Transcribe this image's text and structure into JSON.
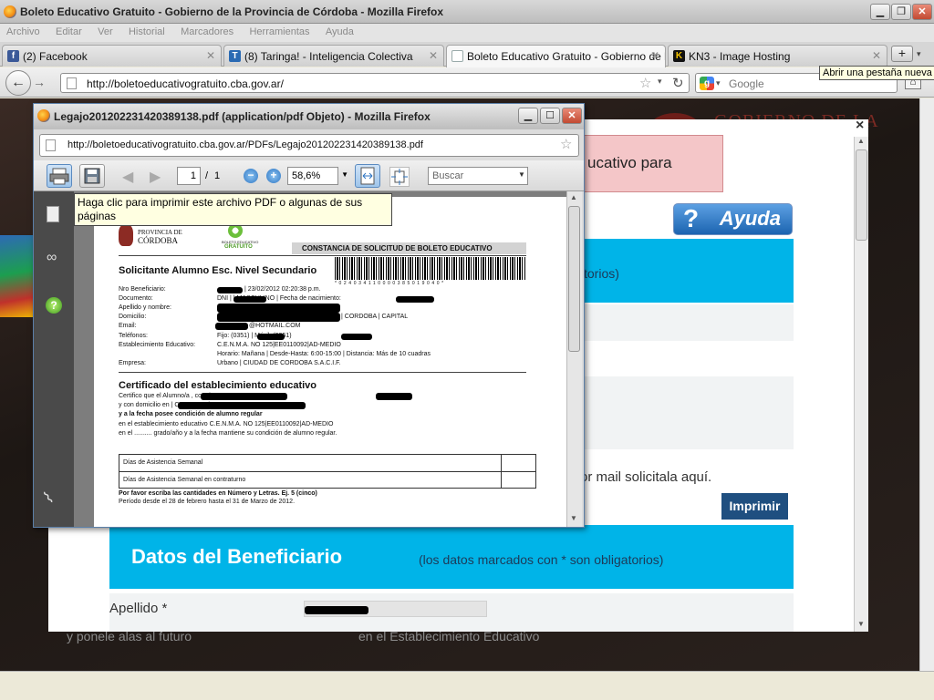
{
  "window": {
    "title": "Boleto Educativo Gratuito - Gobierno de la Provincia de Córdoba - Mozilla Firefox",
    "controls": [
      "▁",
      "❐",
      "✕"
    ]
  },
  "menu": [
    "Archivo",
    "Editar",
    "Ver",
    "Historial",
    "Marcadores",
    "Herramientas",
    "Ayuda"
  ],
  "tabs": [
    {
      "label": "(2) Facebook",
      "icon": "f"
    },
    {
      "label": "(8) Taringa! - Inteligencia Colectiva",
      "icon": "T"
    },
    {
      "label": "Boleto Educativo Gratuito - Gobierno de l...",
      "icon": ""
    },
    {
      "label": "KN3 - Image Hosting",
      "icon": "K"
    }
  ],
  "new_tab_tooltip": "Abrir una pestaña nueva",
  "new_tab_label": "+",
  "address": "http://boletoeducativogratuito.cba.gov.ar/",
  "search": {
    "engine_letter": "g",
    "placeholder": "Google"
  },
  "page": {
    "gobierno_text": "GOBIERNO DE LA",
    "alert_text": "ucativo para",
    "ayuda_label": "Ayuda",
    "obligatorios_fragment": "torios)",
    "mail_text": "or mail solicitala aquí.",
    "imprimir_label": "Imprimir",
    "datos_title": "Datos del Beneficiario",
    "datos_note": "(los datos marcados con * son obligatorios)",
    "apellido_label": "Apellido *",
    "footer_left": "y ponele alas al futuro",
    "footer_right": "en el Establecimiento Educativo",
    "close_label": "×"
  },
  "popup": {
    "title": "Legajo201202231420389138.pdf (application/pdf Objeto) - Mozilla Firefox",
    "url": "http://boletoeducativogratuito.cba.gov.ar/PDFs/Legajo201202231420389138.pdf",
    "page_current": "1",
    "page_sep": "/",
    "page_total": "1",
    "zoom": "58,6%",
    "search_placeholder": "Buscar",
    "tooltip": "Haga clic para imprimir este archivo PDF o algunas de sus páginas"
  },
  "pdf": {
    "logo_gob1": "GOBIERNO DE LA",
    "logo_gob2": "PROVINCIA DE",
    "logo_gob3": "CÓRDOBA",
    "logo_beg1": "BOLETO EDUCATIVO",
    "logo_beg2": "GRATUITO",
    "constancia": "CONSTANCIA DE SOLICITUD DE BOLETO EDUCATIVO",
    "solicitante": "Solicitante Alumno Esc. Nivel Secundario",
    "barcode_text": "*024034110000385019040*",
    "fields": [
      {
        "label": "Nro Beneficiario:",
        "value": "| 23/02/2012 02:20:38 p.m."
      },
      {
        "label": "Documento:",
        "value": "DNI |            | MASCULINO | Fecha de nacimiento:"
      },
      {
        "label": "Apellido y nombre:",
        "value": ""
      },
      {
        "label": "Domicilio:",
        "value": "| CORDOBA | CAPITAL"
      },
      {
        "label": "Email:",
        "value": "@HOTMAIL.COM"
      },
      {
        "label": "Teléfonos:",
        "value": "Fijo: (0351)            | Móvil: (0351)"
      },
      {
        "label": "Establecimiento Educativo:",
        "value": "C.E.N.M.A. NO 125|EE0110092|AD-MEDIO"
      },
      {
        "label": "",
        "value": "Horario: Mañana | Desde-Hasta: 6:00-15:00 | Distancia: Más de 10 cuadras"
      },
      {
        "label": "Empresa:",
        "value": "Urbano | CIUDAD DE CORDOBA S.A.C.I.F."
      }
    ],
    "cert_title": "Certificado del establecimiento educativo",
    "cert_lines": [
      "Certifico que el Alumno/a                                , con documento DNI",
      "y con domicilio en                                              | CORDOBA | CAPITAL",
      "y a la fecha posee condición de alumno regular",
      "en el establecimiento educativo C.E.N.M.A. NO 125|EE0110092|AD-MEDIO",
      "en el .......... grado/año y a la fecha mantiene su condición de alumno regular."
    ],
    "table_rows": [
      "Días de Asistencia Semanal",
      "Días de Asistencia Semanal en contraturno"
    ],
    "note1": "Por favor escriba las cantidades en Número y Letras. Ej. 5 (cinco)",
    "note2": "Período desde el 28 de febrero hasta el 31 de Marzo de 2012."
  },
  "colors": {
    "cyan": "#00b4e8",
    "navy": "#1f4f80",
    "alert_bg": "#f4c6c8",
    "ayuda_bg": "#1c64b0"
  }
}
